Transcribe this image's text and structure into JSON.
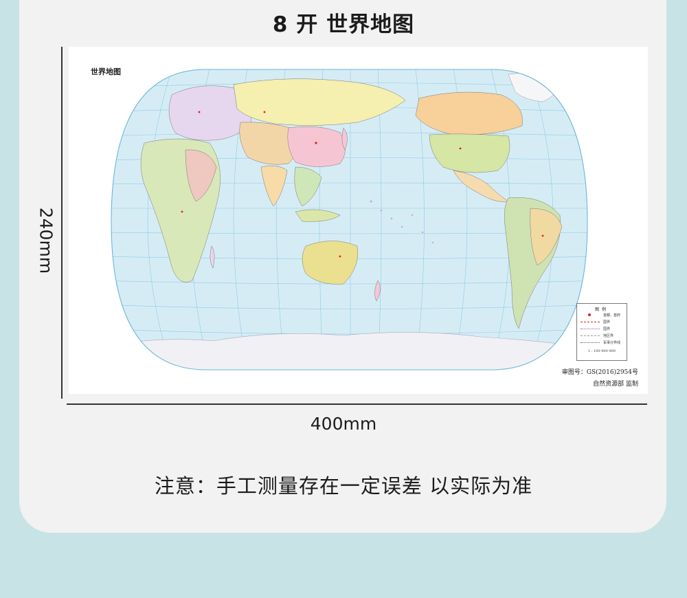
{
  "header": {
    "title": "8 开  世界地图"
  },
  "dimensions": {
    "height_label": "240mm",
    "width_label": "400mm"
  },
  "map": {
    "title": "世界地图",
    "approval_number": "审图号：GS(2016)2954号",
    "publisher": "自然资源部  监制",
    "legend": {
      "title": "图例",
      "items": [
        {
          "label": "首都、首府"
        },
        {
          "label": "国界"
        },
        {
          "label": "国界"
        },
        {
          "label": "地区界"
        },
        {
          "label": "军事分界线"
        }
      ],
      "scale": "1 : 100 000 000"
    }
  },
  "footer": {
    "note": "注意：手工测量存在一定误差  以实际为准"
  },
  "colors": {
    "page_background": "#c8e3e6",
    "card_background": "#f2f2f2",
    "ocean": "#d6ecf5",
    "graticule": "#8ccbe3",
    "antarctica": "#f1f1f5"
  }
}
